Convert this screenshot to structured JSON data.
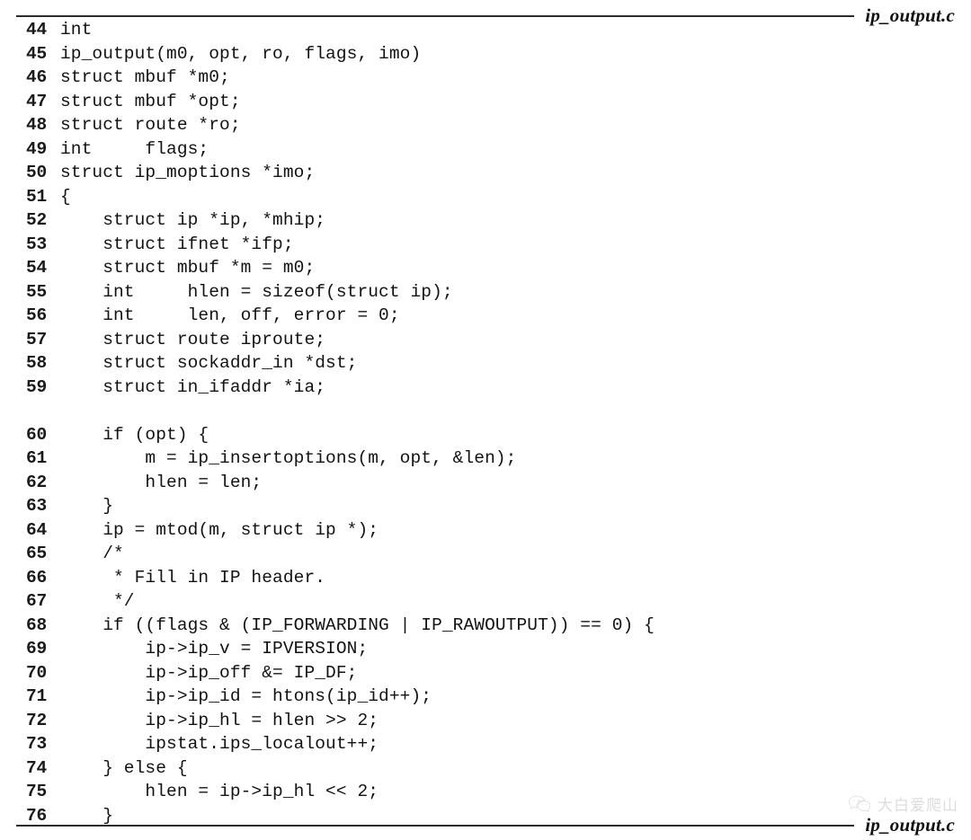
{
  "header": {
    "filename": "ip_output.c"
  },
  "footer": {
    "filename": "ip_output.c"
  },
  "listing": {
    "language": "c",
    "first_line": 44,
    "last_line": 76,
    "lines": [
      {
        "no": "44",
        "code": "int"
      },
      {
        "no": "45",
        "code": "ip_output(m0, opt, ro, flags, imo)"
      },
      {
        "no": "46",
        "code": "struct mbuf *m0;"
      },
      {
        "no": "47",
        "code": "struct mbuf *opt;"
      },
      {
        "no": "48",
        "code": "struct route *ro;"
      },
      {
        "no": "49",
        "code": "int     flags;"
      },
      {
        "no": "50",
        "code": "struct ip_moptions *imo;"
      },
      {
        "no": "51",
        "code": "{"
      },
      {
        "no": "52",
        "code": "    struct ip *ip, *mhip;"
      },
      {
        "no": "53",
        "code": "    struct ifnet *ifp;"
      },
      {
        "no": "54",
        "code": "    struct mbuf *m = m0;"
      },
      {
        "no": "55",
        "code": "    int     hlen = sizeof(struct ip);"
      },
      {
        "no": "56",
        "code": "    int     len, off, error = 0;"
      },
      {
        "no": "57",
        "code": "    struct route iproute;"
      },
      {
        "no": "58",
        "code": "    struct sockaddr_in *dst;"
      },
      {
        "no": "59",
        "code": "    struct in_ifaddr *ia;"
      },
      {
        "no": "",
        "code": ""
      },
      {
        "no": "60",
        "code": "    if (opt) {"
      },
      {
        "no": "61",
        "code": "        m = ip_insertoptions(m, opt, &len);"
      },
      {
        "no": "62",
        "code": "        hlen = len;"
      },
      {
        "no": "63",
        "code": "    }"
      },
      {
        "no": "64",
        "code": "    ip = mtod(m, struct ip *);"
      },
      {
        "no": "65",
        "code": "    /*"
      },
      {
        "no": "66",
        "code": "     * Fill in IP header."
      },
      {
        "no": "67",
        "code": "     */"
      },
      {
        "no": "68",
        "code": "    if ((flags & (IP_FORWARDING | IP_RAWOUTPUT)) == 0) {"
      },
      {
        "no": "69",
        "code": "        ip->ip_v = IPVERSION;"
      },
      {
        "no": "70",
        "code": "        ip->ip_off &= IP_DF;"
      },
      {
        "no": "71",
        "code": "        ip->ip_id = htons(ip_id++);"
      },
      {
        "no": "72",
        "code": "        ip->ip_hl = hlen >> 2;"
      },
      {
        "no": "73",
        "code": "        ipstat.ips_localout++;"
      },
      {
        "no": "74",
        "code": "    } else {"
      },
      {
        "no": "75",
        "code": "        hlen = ip->ip_hl << 2;"
      },
      {
        "no": "76",
        "code": "    }"
      }
    ]
  },
  "watermark": {
    "icon": "wechat-icon",
    "text": "大白爱爬山"
  },
  "colors": {
    "page_background": "#ffffff",
    "text": "#121212",
    "rule": "#2b2b2b",
    "watermark": "#8f8f8f"
  }
}
